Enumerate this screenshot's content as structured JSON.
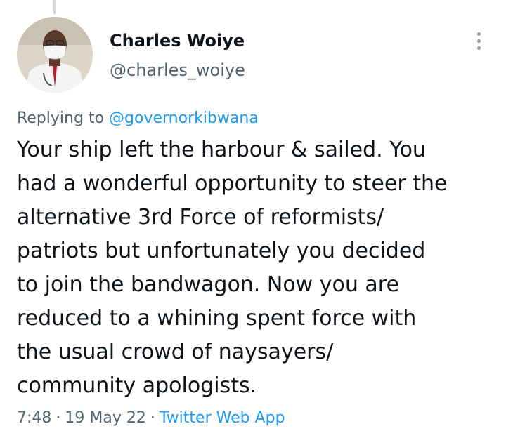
{
  "tweet": {
    "author": {
      "display_name": "Charles Woiye",
      "handle": "@charles_woiye"
    },
    "more_icon": "more-vertical-icon",
    "replying_prefix": "Replying to",
    "replying_to": "@governorkibwana",
    "text_lines": [
      "Your ship left the harbour & sailed. You",
      "had a wonderful opportunity to steer the",
      "alternative 3rd Force of reformists/",
      "patriots but unfortunately you decided",
      "to join the bandwagon. Now you are",
      "reduced to a whining spent force with",
      "the usual crowd of naysayers/",
      "community apologists."
    ],
    "time": "7:48",
    "separator": "·",
    "date": "19 May 22",
    "source": "Twitter Web App"
  },
  "colors": {
    "text_primary": "#0f1419",
    "text_secondary": "#536471",
    "accent": "#1d9bf0"
  }
}
